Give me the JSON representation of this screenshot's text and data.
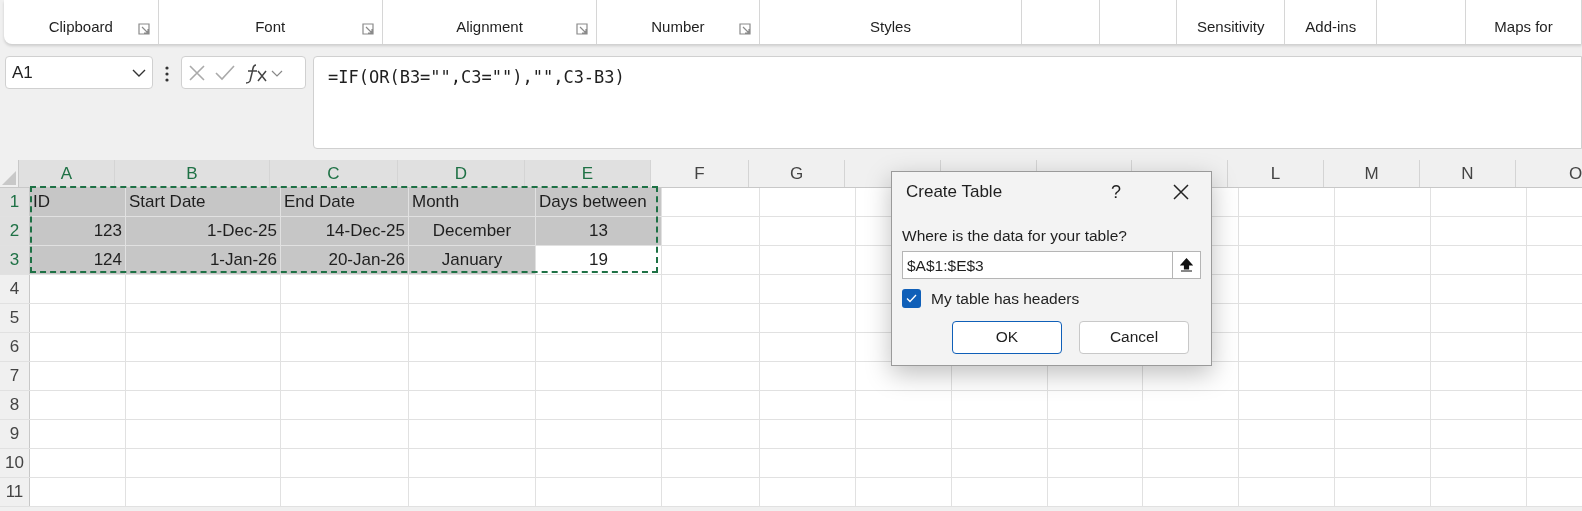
{
  "ribbon": {
    "groups": [
      {
        "label": "Clipboard",
        "launcher": true
      },
      {
        "label": "Font",
        "launcher": true
      },
      {
        "label": "Alignment",
        "launcher": true
      },
      {
        "label": "Number",
        "launcher": true
      },
      {
        "label": "Styles",
        "launcher": false
      },
      {
        "label": "Sensitivity",
        "launcher": false
      },
      {
        "label": "Add-ins",
        "launcher": false
      },
      {
        "label": "Maps for",
        "launcher": false
      }
    ]
  },
  "name_box": {
    "value": "A1"
  },
  "formula_bar": {
    "value": "=IF(OR(B3=\"\",C3=\"\"),\"\",C3-B3)"
  },
  "columns": [
    {
      "label": "A",
      "selected": true
    },
    {
      "label": "B",
      "selected": true
    },
    {
      "label": "C",
      "selected": true
    },
    {
      "label": "D",
      "selected": true
    },
    {
      "label": "E",
      "selected": true
    },
    {
      "label": "F",
      "selected": false
    },
    {
      "label": "G",
      "selected": false
    },
    {
      "label": "L",
      "selected": false
    },
    {
      "label": "M",
      "selected": false
    },
    {
      "label": "N",
      "selected": false
    },
    {
      "label": "O",
      "selected": false
    }
  ],
  "rows": [
    {
      "label": "1",
      "selected": true,
      "cells": [
        {
          "text": "ID",
          "kind": "text",
          "selected": true
        },
        {
          "text": "Start Date",
          "kind": "text",
          "selected": true
        },
        {
          "text": "End Date",
          "kind": "text",
          "selected": true
        },
        {
          "text": "Month",
          "kind": "text",
          "selected": true
        },
        {
          "text": "Days between",
          "kind": "text",
          "selected": true
        }
      ]
    },
    {
      "label": "2",
      "selected": true,
      "cells": [
        {
          "text": "123",
          "kind": "number",
          "selected": true
        },
        {
          "text": "1-Dec-25",
          "kind": "number",
          "selected": true
        },
        {
          "text": "14-Dec-25",
          "kind": "number",
          "selected": true
        },
        {
          "text": "December",
          "kind": "centered",
          "selected": true
        },
        {
          "text": "13",
          "kind": "centered",
          "selected": true
        }
      ]
    },
    {
      "label": "3",
      "selected": true,
      "cells": [
        {
          "text": "124",
          "kind": "number",
          "selected": true
        },
        {
          "text": "1-Jan-26",
          "kind": "number",
          "selected": true
        },
        {
          "text": "20-Jan-26",
          "kind": "number",
          "selected": true
        },
        {
          "text": "January",
          "kind": "centered",
          "selected": true
        },
        {
          "text": "19",
          "kind": "centered",
          "selected": false
        }
      ]
    },
    {
      "label": "4",
      "selected": false,
      "cells": []
    },
    {
      "label": "5",
      "selected": false,
      "cells": []
    },
    {
      "label": "6",
      "selected": false,
      "cells": []
    },
    {
      "label": "7",
      "selected": false,
      "cells": []
    },
    {
      "label": "8",
      "selected": false,
      "cells": []
    },
    {
      "label": "9",
      "selected": false,
      "cells": []
    },
    {
      "label": "10",
      "selected": false,
      "cells": []
    },
    {
      "label": "11",
      "selected": false,
      "cells": []
    }
  ],
  "dialog": {
    "title": "Create Table",
    "help": "?",
    "prompt": "Where is the data for your table?",
    "range": "$A$1:$E$3",
    "headers_checkbox": {
      "label": "My table has headers",
      "checked": true
    },
    "buttons": [
      {
        "label": "OK",
        "default": true
      },
      {
        "label": "Cancel",
        "default": false
      }
    ]
  }
}
